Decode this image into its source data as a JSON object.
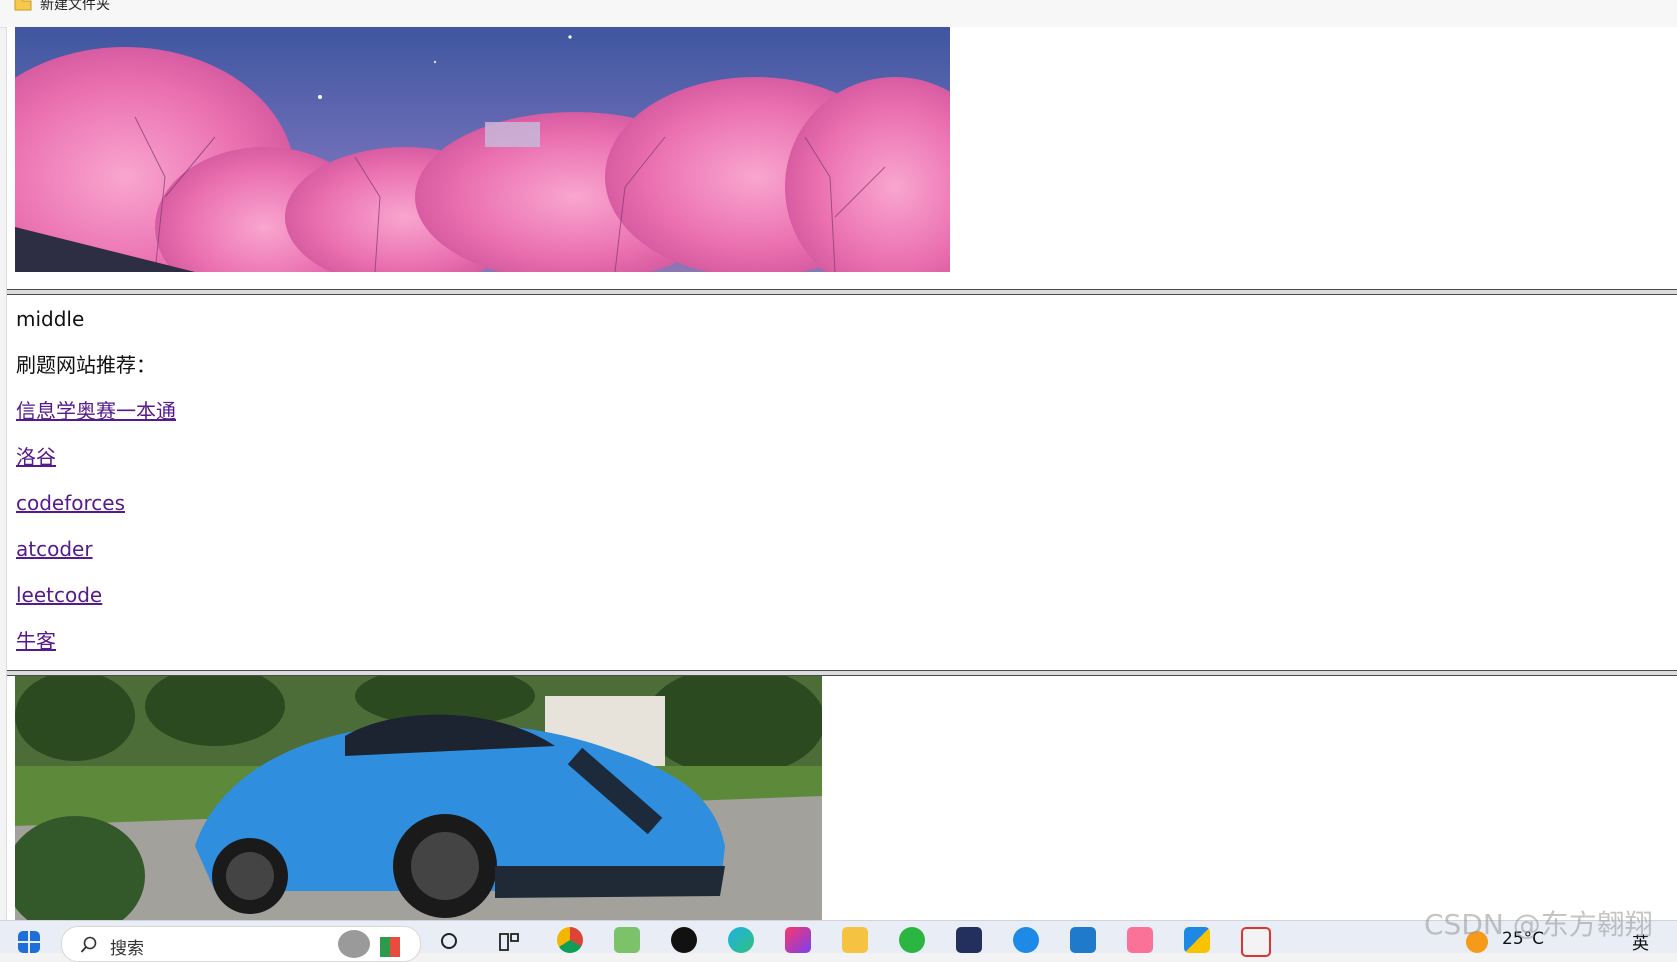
{
  "bookmarks": {
    "folder_label": "新建文件夹"
  },
  "frames": {
    "top": {
      "image": "pink cherry blossom trees under night sky"
    },
    "middle": {
      "title": "middle",
      "recommend_label": "刷题网站推荐：",
      "links": [
        "信息学奥赛一本通",
        "洛谷",
        "codeforces",
        "atcoder",
        "leetcode",
        "牛客"
      ]
    },
    "bottom": {
      "image": "blue sports car on road"
    }
  },
  "taskbar": {
    "search_placeholder": "搜索",
    "weather": "25°C",
    "ime": "英"
  },
  "watermark": "CSDN @东方翱翔"
}
